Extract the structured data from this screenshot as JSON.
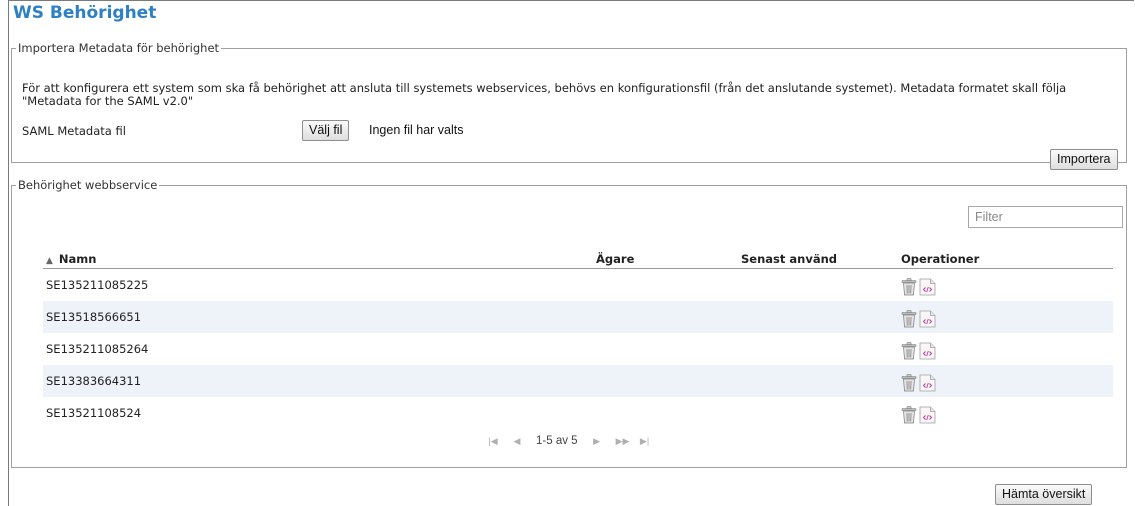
{
  "page": {
    "title": "WS Behörighet"
  },
  "import_section": {
    "legend": "Importera Metadata för behörighet",
    "description": "För att konfigurera ett system som ska få behörighet att ansluta till systemets webservices, behövs en konfigurationsfil (från det anslutande systemet). Metadata formatet skall följa \"Metadata for the SAML v2.0\"",
    "file_label": "SAML Metadata fil",
    "choose_file_label": "Välj fil",
    "no_file_text": "Ingen fil har valts",
    "import_button": "Importera"
  },
  "ws_section": {
    "legend": "Behörighet webbservice",
    "filter_placeholder": "Filter",
    "columns": {
      "name": "Namn",
      "owner": "Ägare",
      "last_used": "Senast använd",
      "operations": "Operationer"
    },
    "rows": [
      {
        "name": "SE135211085225",
        "owner": "",
        "last_used": ""
      },
      {
        "name": "SE13518566651",
        "owner": "",
        "last_used": ""
      },
      {
        "name": "SE135211085264",
        "owner": "",
        "last_used": ""
      },
      {
        "name": "SE13383664311",
        "owner": "",
        "last_used": ""
      },
      {
        "name": "SE13521108524",
        "owner": "",
        "last_used": ""
      }
    ],
    "pager": {
      "label": "1-5 av 5"
    }
  },
  "footer": {
    "overview_button": "Hämta översikt"
  },
  "icons": {
    "sort": "sort-asc-icon",
    "delete": "trash-icon",
    "view": "code-document-icon",
    "pager": [
      "first-page-icon",
      "prev-page-icon",
      "next-page-icon",
      "fast-forward-icon",
      "last-page-icon"
    ]
  },
  "colors": {
    "title": "#2e80c4",
    "row_alt": "#eef3f9",
    "code_icon": "#c0389a"
  }
}
